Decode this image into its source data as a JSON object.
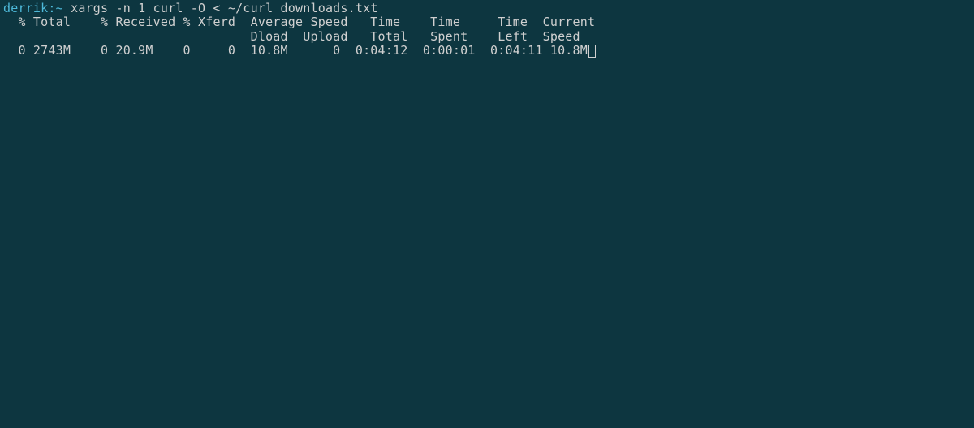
{
  "prompt": {
    "user": "derrik",
    "sep1": ":",
    "path": "~",
    "sep2": " ",
    "command": "xargs -n 1 curl -O < ~/curl_downloads.txt"
  },
  "curl": {
    "header_line1": "  % Total    % Received % Xferd  Average Speed   Time    Time     Time  Current",
    "header_line2": "                                 Dload  Upload   Total   Spent    Left  Speed",
    "row": "  0 2743M    0 20.9M    0     0  10.8M      0  0:04:12  0:00:01  0:04:11 10.8M"
  }
}
